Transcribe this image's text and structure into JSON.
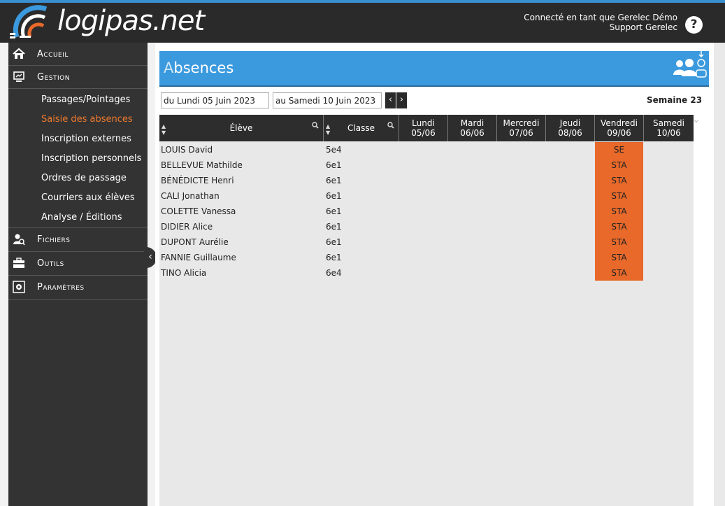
{
  "header": {
    "logo_main": "logipas",
    "logo_tld": ".net",
    "user_line1": "Connecté en tant que Gerelec Démo",
    "user_line2": "Support Gerelec",
    "help_glyph": "?"
  },
  "sidebar": {
    "sections": [
      {
        "label": "Accueil",
        "icon": "home-icon"
      },
      {
        "label": "Gestion",
        "icon": "monitor-icon"
      }
    ],
    "gestion_items": [
      {
        "label": "Passages/Pointages",
        "active": false
      },
      {
        "label": "Saisie des absences",
        "active": true
      },
      {
        "label": "Inscription externes",
        "active": false
      },
      {
        "label": "Inscription personnels",
        "active": false
      },
      {
        "label": "Ordres de passage",
        "active": false
      },
      {
        "label": "Courriers aux élèves",
        "active": false
      },
      {
        "label": "Analyse / Éditions",
        "active": false
      }
    ],
    "bottom_sections": [
      {
        "label": "Fichiers",
        "icon": "user-search-icon"
      },
      {
        "label": "Outils",
        "icon": "toolbox-icon"
      },
      {
        "label": "Paramètres",
        "icon": "settings-icon"
      }
    ],
    "collapse_glyph": "‹"
  },
  "page": {
    "title_first": "A",
    "title_rest": "bsences",
    "date_from": "du Lundi 05 Juin 2023",
    "date_to": "au Samedi 10 Juin 2023",
    "prev_glyph": "‹",
    "next_glyph": "›",
    "week_label": "Semaine 23"
  },
  "table": {
    "col_eleve": "Élève",
    "col_classe": "Classe",
    "days": [
      {
        "name": "Lundi",
        "date": "05/06"
      },
      {
        "name": "Mardi",
        "date": "06/06"
      },
      {
        "name": "Mercredi",
        "date": "07/06"
      },
      {
        "name": "Jeudi",
        "date": "08/06"
      },
      {
        "name": "Vendredi",
        "date": "09/06"
      },
      {
        "name": "Samedi",
        "date": "10/06"
      }
    ],
    "rows": [
      {
        "name": "LOUIS David",
        "classe": "5e4",
        "vendredi": "SE"
      },
      {
        "name": "BELLEVUE Mathilde",
        "classe": "6e1",
        "vendredi": "STA"
      },
      {
        "name": "BÉNÉDICTE Henri",
        "classe": "6e1",
        "vendredi": "STA"
      },
      {
        "name": "CALI Jonathan",
        "classe": "6e1",
        "vendredi": "STA"
      },
      {
        "name": "COLETTE Vanessa",
        "classe": "6e1",
        "vendredi": "STA"
      },
      {
        "name": "DIDIER Alice",
        "classe": "6e1",
        "vendredi": "STA"
      },
      {
        "name": "DUPONT Aurélie",
        "classe": "6e1",
        "vendredi": "STA"
      },
      {
        "name": "FANNIE Guillaume",
        "classe": "6e1",
        "vendredi": "STA"
      },
      {
        "name": "TINO Alicia",
        "classe": "6e4",
        "vendredi": "STA"
      }
    ]
  },
  "colors": {
    "accent_blue": "#3b9ade",
    "absence_orange": "#e8692a",
    "active_menu": "#ee7a2e",
    "sidebar_bg": "#333333"
  }
}
